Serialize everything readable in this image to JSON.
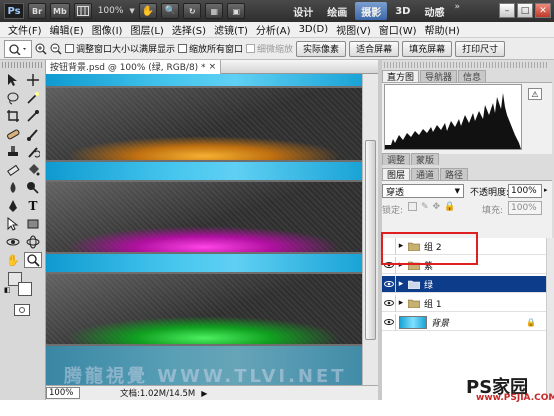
{
  "titlebar": {
    "app_logo": "Ps",
    "bridge_btn": "Br",
    "mini_btn": "Mb",
    "zoom": "100%",
    "workspaces": [
      "设计",
      "绘画",
      "摄影",
      "3D",
      "动感"
    ],
    "active_workspace": "摄影"
  },
  "menubar": {
    "items": [
      "文件(F)",
      "编辑(E)",
      "图像(I)",
      "图层(L)",
      "选择(S)",
      "滤镜(T)",
      "分析(A)",
      "3D(D)",
      "视图(V)",
      "窗口(W)",
      "帮助(H)"
    ]
  },
  "options": {
    "resize_windows": "调整窗口大小以满屏显示",
    "zoom_all": "缩放所有窗口",
    "scrubby_zoom": "细微缩放",
    "actual_pixels": "实际像素",
    "fit_screen": "适合屏幕",
    "fill_screen": "填充屏幕",
    "print_size": "打印尺寸"
  },
  "document": {
    "tab_title": "按钮背景.psd @ 100% (绿, RGB/8) *",
    "close_icon": "×",
    "zoom_value": "100%",
    "doc_size": "文档:1.02M/14.5M",
    "watermark": "腾龍視覺 WWW.TLVI.NET"
  },
  "histogram_panel": {
    "tabs": [
      "直方图",
      "导航器",
      "信息"
    ],
    "active_tab": "直方图"
  },
  "adjust_panel": {
    "tabs": [
      "调整",
      "蒙版"
    ]
  },
  "layers_panel": {
    "tabs": [
      "图层",
      "通道",
      "路径"
    ],
    "active_tab": "图层",
    "blend_mode": "穿透",
    "opacity_label": "不透明度:",
    "opacity_value": "100%",
    "lock_label": "锁定:",
    "fill_label": "填充:",
    "fill_value": "100%",
    "layers": [
      {
        "name": "组 2",
        "type": "group",
        "visible": false,
        "selected": false
      },
      {
        "name": "紫",
        "type": "group",
        "visible": true,
        "selected": false
      },
      {
        "name": "绿",
        "type": "group",
        "visible": true,
        "selected": true
      },
      {
        "name": "组 1",
        "type": "group",
        "visible": true,
        "selected": false
      },
      {
        "name": "背景",
        "type": "layer",
        "visible": true,
        "selected": false
      }
    ]
  },
  "branding": {
    "logo": "PS家园",
    "url": "www.PSJIA.COM"
  },
  "colors": {
    "selected_row": "#0d3c8a",
    "highlight_box": "#e02020",
    "cyan_band": "#2bb6e6",
    "glow_orange": "#f0a020",
    "glow_magenta": "#e020c8",
    "glow_green": "#20d040"
  }
}
